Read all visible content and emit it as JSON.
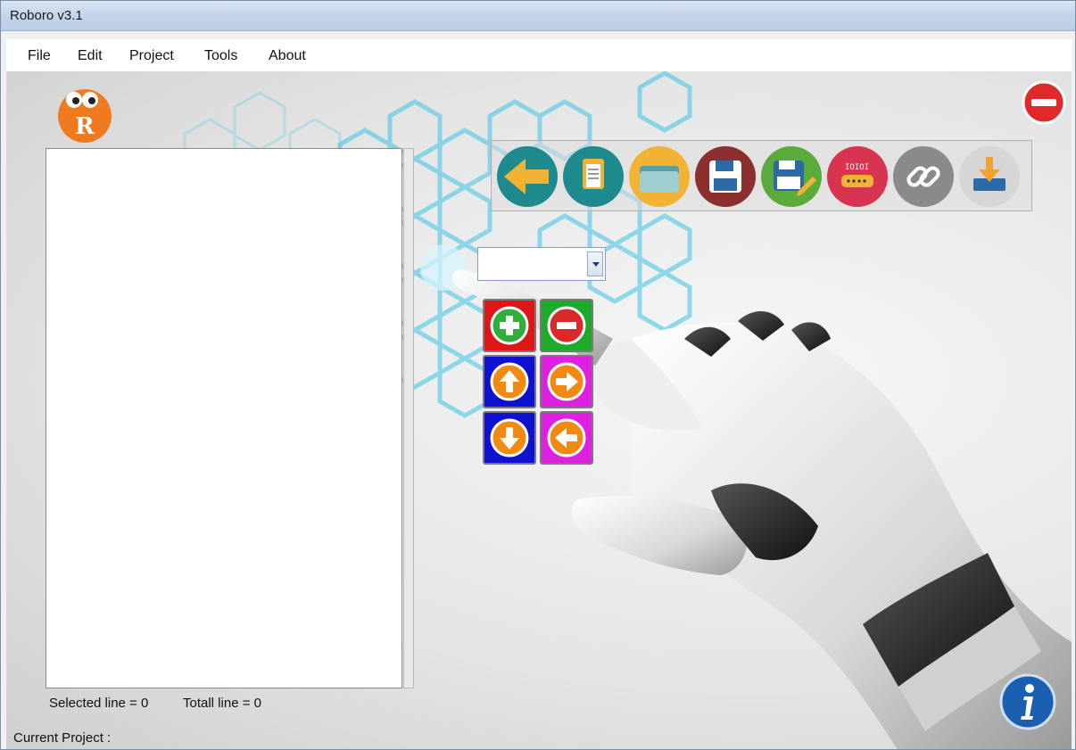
{
  "window": {
    "title": "Roboro v3.1"
  },
  "menu": [
    "File",
    "Edit",
    "Project",
    "Tools",
    "About"
  ],
  "toolbar": {
    "buttons": [
      {
        "icon": "back-arrow-icon",
        "color": "#1f8a8e"
      },
      {
        "icon": "new-document-icon",
        "color": "#1f8a8e"
      },
      {
        "icon": "open-folder-icon",
        "color": "#f2b233"
      },
      {
        "icon": "save-icon",
        "color": "#8b2f2f"
      },
      {
        "icon": "save-as-icon",
        "color": "#5aaa3c"
      },
      {
        "icon": "serial-port-icon",
        "color": "#d8334f"
      },
      {
        "icon": "link-icon",
        "color": "#8a8a8a"
      },
      {
        "icon": "download-icon",
        "color": "#c8c8c8"
      }
    ]
  },
  "command_select": {
    "value": ""
  },
  "pad": {
    "buttons": [
      {
        "icon": "add-icon",
        "bg": "#e01515"
      },
      {
        "icon": "remove-icon",
        "bg": "#1eaa2a"
      },
      {
        "icon": "arrow-up-icon",
        "bg": "#1010d0"
      },
      {
        "icon": "arrow-right-icon",
        "bg": "#e020e0"
      },
      {
        "icon": "arrow-down-icon",
        "bg": "#1010d0"
      },
      {
        "icon": "arrow-left-icon",
        "bg": "#e020e0"
      }
    ]
  },
  "status": {
    "selected_label": "Selected line = 0",
    "total_label": "Totall line = 0",
    "current_project_label": "Current Project :"
  },
  "logo_letter": "R"
}
